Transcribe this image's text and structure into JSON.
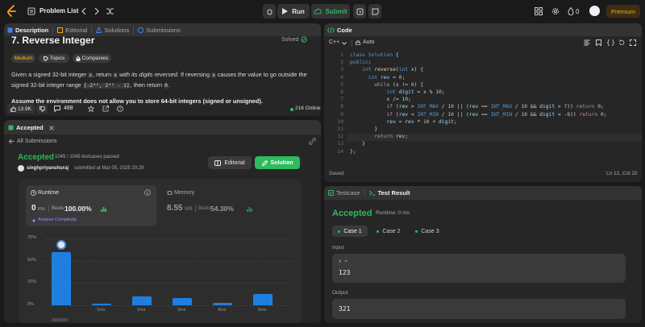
{
  "topbar": {
    "problem_list": "Problem List",
    "run": "Run",
    "submit": "Submit",
    "streak": "0",
    "premium": "Premium"
  },
  "description": {
    "tabs": [
      "Description",
      "Editorial",
      "Solutions",
      "Submissions"
    ],
    "title": "7. Reverse Integer",
    "solved": "Solved",
    "tags": [
      "Medium",
      "Topics",
      "Companies"
    ],
    "para1_a": "Given a signed 32-bit integer",
    "para1_x": "x",
    "para1_b": ", return",
    "para1_c": "x",
    "para1_d": "with its digits reversed",
    "para1_e": ". If reversing",
    "para1_f": "x",
    "para1_g": "causes the value to go outside the",
    "para2_a": "signed 32-bit integer range",
    "para2_range": "[-2³¹, 2³¹ - 1]",
    "para2_b": ", then return",
    "para2_zero": "0",
    "para2_c": ".",
    "para3": "Assume the environment does not allow you to store 64-bit integers (signed or unsigned).",
    "likes": "13.9K",
    "comments": "488",
    "online": "216 Online"
  },
  "submission": {
    "tab": "Accepted",
    "all_submissions": "All Submissions",
    "status": "Accepted",
    "testcases": "1045 / 1045 testcases passed",
    "user": "singhpriyanshuraj",
    "submitted": "submitted at Mar 05, 2025 20:29",
    "editorial_btn": "Editorial",
    "solution_btn": "Solution",
    "runtime_label": "Runtime",
    "runtime_value": "0",
    "runtime_unit": "ms",
    "beats_label": "Beats",
    "beats_value": "100.00%",
    "analyze": "Analyze Complexity",
    "memory_label": "Memory",
    "memory_value": "8.55",
    "memory_unit": "MB",
    "memory_beats_label": "Beats",
    "memory_beats_value": "54.30%"
  },
  "chart_data": {
    "type": "bar",
    "y_ticks": [
      "75%",
      "50%",
      "25%",
      "0%"
    ],
    "x_ticks": [
      "1ms",
      "2ms",
      "3ms",
      "4ms",
      "5ms"
    ],
    "values": [
      60,
      2,
      10,
      8,
      3,
      13
    ],
    "ylim": [
      0,
      75
    ]
  },
  "code": {
    "tab": "Code",
    "language": "C++",
    "auto": "Auto",
    "lines": [
      "class Solution {",
      "public:",
      "    int reverse(int x) {",
      "      int rev = 0;",
      "        while (x != 0) {",
      "            int digit = x % 10;",
      "            x /= 10;",
      "            if (rev > INT_MAX / 10 || (rev == INT_MAX / 10 && digit > 7)) return 0;",
      "            if (rev < INT_MIN / 10 || (rev == INT_MIN / 10 && digit < -8)) return 0;",
      "            rev = rev * 10 + digit;",
      "        }",
      "        return rev;",
      "    }",
      "};"
    ],
    "saved": "Saved",
    "cursor": "Ln 12, Col 20"
  },
  "result": {
    "tabs": [
      "Testcase",
      "Test Result"
    ],
    "status": "Accepted",
    "runtime": "Runtime: 0 ms",
    "cases": [
      "Case 1",
      "Case 2",
      "Case 3"
    ],
    "input_label": "Input",
    "input_var": "x =",
    "input_value": "123",
    "output_label": "Output",
    "output_value": "321"
  },
  "colors": {
    "accent_green": "#2cbb5d",
    "accent_orange": "#ffa116",
    "bar_blue": "#1e7fe0"
  }
}
